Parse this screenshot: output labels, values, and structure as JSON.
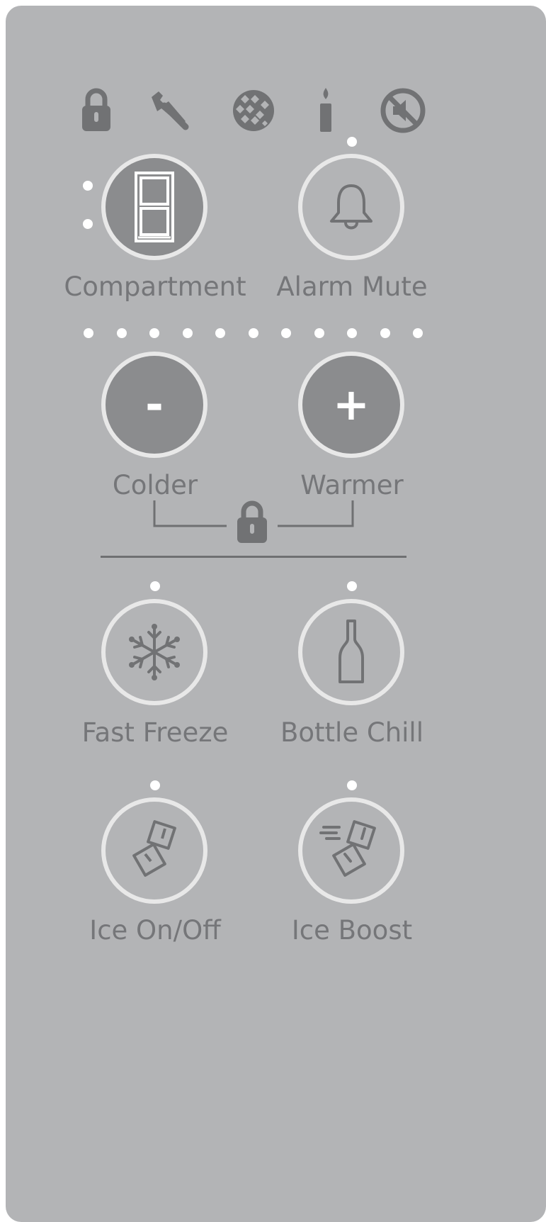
{
  "colors": {
    "panel": "#b3b4b6",
    "button_dark": "#8b8c8e",
    "button_ring": "#e8e8e8",
    "icon_gray": "#717274",
    "label_gray": "#757679",
    "indicator": "#ffffff"
  },
  "status_icons": [
    "lock-icon",
    "wrench-icon",
    "filter-icon",
    "candle-icon",
    "mute-icon"
  ],
  "controls": {
    "compartment": {
      "label": "Compartment",
      "icon": "fridge-icon"
    },
    "alarm_mute": {
      "label": "Alarm Mute",
      "icon": "bell-icon"
    },
    "colder": {
      "label": "Colder",
      "glyph": "-"
    },
    "warmer": {
      "label": "Warmer",
      "glyph": "+"
    },
    "fast_freeze": {
      "label": "Fast Freeze",
      "icon": "snowflake-icon"
    },
    "bottle_chill": {
      "label": "Bottle Chill",
      "icon": "bottle-icon"
    },
    "ice_on_off": {
      "label": "Ice On/Off",
      "icon": "ice-cubes-icon"
    },
    "ice_boost": {
      "label": "Ice Boost",
      "icon": "ice-boost-icon"
    }
  },
  "temperature_indicator_count": 11
}
